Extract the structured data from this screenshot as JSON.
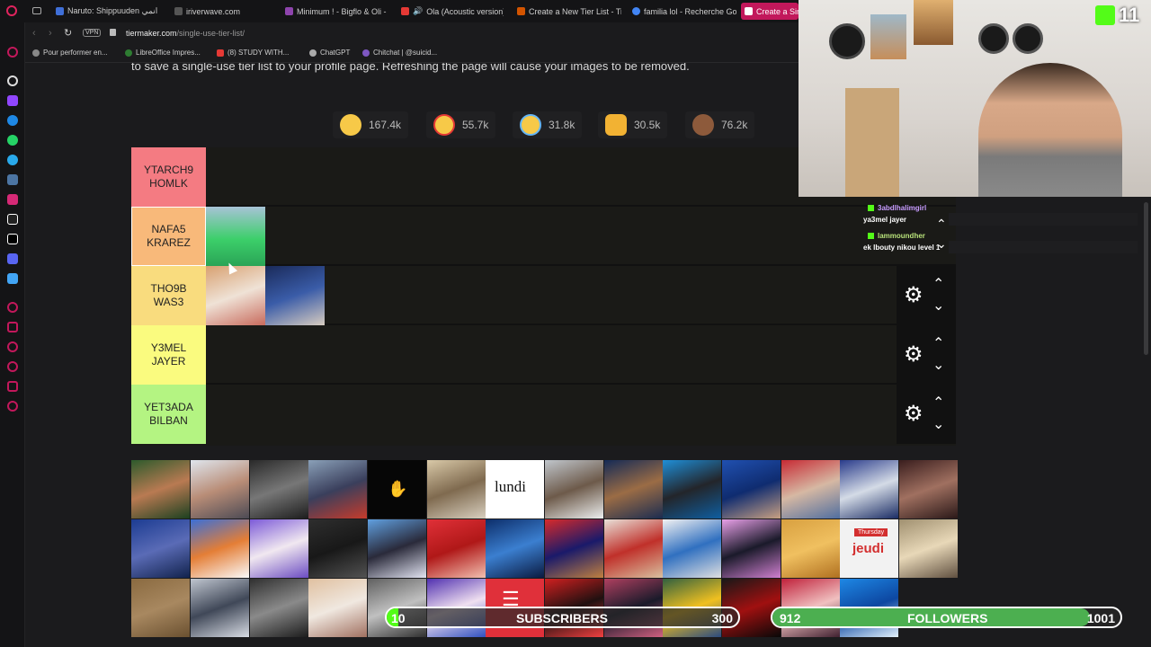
{
  "browser": {
    "tabs": [
      {
        "label": "Naruto: Shippuuden انمي",
        "color": "#3f6fd8"
      },
      {
        "label": "iriverwave.com",
        "color": "#555"
      },
      {
        "label": "Minimum ! - Bigflo & Oli -",
        "color": "#8e44ad"
      },
      {
        "label": "Ola (Acoustic version)",
        "color": "#e53935"
      },
      {
        "label": "Create a New Tier List - Ti",
        "color": "#d35400"
      },
      {
        "label": "familia lol - Recherche Go",
        "color": "#4285f4"
      },
      {
        "label": "Create a Sin",
        "color": "#ffffff"
      }
    ],
    "vpn": "VPN",
    "url_host": "tiermaker.com",
    "url_path": "/single-use-tier-list/",
    "bookmarks": [
      {
        "label": "Pour performer en...",
        "color": "#888"
      },
      {
        "label": "LibreOffice Impres...",
        "color": "#2e7d32"
      },
      {
        "label": "(8) STUDY WITH...",
        "color": "#e53935"
      },
      {
        "label": "ChatGPT",
        "color": "#aaa"
      },
      {
        "label": "Chitchat | @suicid...",
        "color": "#7e57c2"
      }
    ]
  },
  "page": {
    "intro_text": "to save a single-use tier list to your profile page. Refreshing the page will cause your images to be removed.",
    "reactions": [
      {
        "icon": "grinning-face-icon",
        "count": "167.4k",
        "color": "#f7c948"
      },
      {
        "icon": "heart-eyes-face-icon",
        "count": "55.7k",
        "color": "#f7c948"
      },
      {
        "icon": "laughing-face-icon",
        "count": "31.8k",
        "color": "#f7c948"
      },
      {
        "icon": "raised-hands-icon",
        "count": "30.5k",
        "color": "#f2b233"
      },
      {
        "icon": "poop-icon",
        "count": "76.2k",
        "color": "#8d5a3b"
      }
    ]
  },
  "tiers": [
    {
      "label": "YTARCH9\nHOMLK",
      "color": "#f47b82"
    },
    {
      "label": "NAFA5\nKRAREZ",
      "color": "#f8b97a"
    },
    {
      "label": "THO9B\nWAS3",
      "color": "#f9dc7e"
    },
    {
      "label": "Y3MEL\nJAYER",
      "color": "#fafb7f"
    },
    {
      "label": "YET3ADA\nBILBAN",
      "color": "#b4f482"
    }
  ],
  "bench": {
    "lundi": "lundi",
    "jeudi": "jeudi",
    "thursday": "Thursday"
  },
  "chat": [
    {
      "user": "3abdlhalimgirl",
      "message": "ya3mel jayer"
    },
    {
      "user": "lammoundher",
      "message": "ek lbouty nikou level 1"
    }
  ],
  "stream": {
    "kick_count": "11",
    "subscribers": {
      "label": "SUBSCRIBERS",
      "current": "10",
      "goal": "300",
      "progress": 0.033
    },
    "followers": {
      "label": "FOLLOWERS",
      "current": "912",
      "goal": "1001",
      "progress": 0.911
    }
  }
}
